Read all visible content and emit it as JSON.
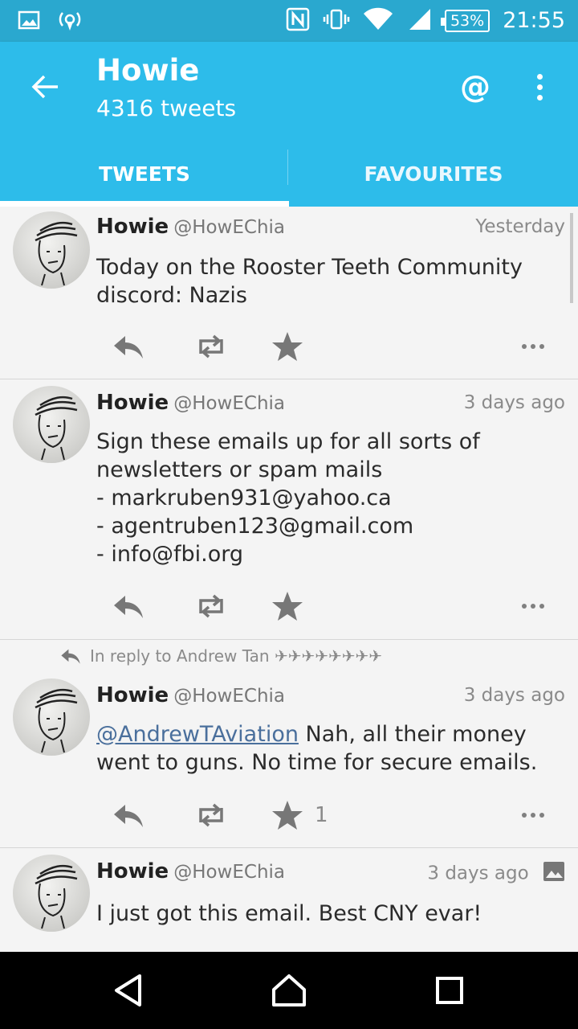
{
  "status_bar": {
    "battery": "53%",
    "time": "21:55",
    "icons": [
      "image-icon",
      "wifi-tether-icon",
      "nfc-icon",
      "vibrate-icon",
      "wifi-icon",
      "signal-icon",
      "battery-icon"
    ]
  },
  "app_bar": {
    "title": "Howie",
    "subtitle": "4316 tweets",
    "color": "#2dbcea"
  },
  "tabs": [
    {
      "label": "TWEETS",
      "active": true
    },
    {
      "label": "FAVOURITES",
      "active": false
    }
  ],
  "tweets": [
    {
      "name": "Howie",
      "handle": "@HowEChia",
      "time": "Yesterday",
      "text": "Today on the Rooster Teeth Community discord: Nazis"
    },
    {
      "name": "Howie",
      "handle": "@HowEChia",
      "time": "3 days ago",
      "text": "Sign these emails up for all sorts of newsletters or spam mails\n- markruben931@yahoo.ca\n- agentruben123@gmail.com\n- info@fbi.org"
    },
    {
      "in_reply_to": "In reply to Andrew Tan ✈✈✈✈✈✈✈✈",
      "name": "Howie",
      "handle": "@HowEChia",
      "time": "3 days ago",
      "mention": "@AndrewTAviation",
      "text": " Nah, all their money went to guns. No time for secure emails.",
      "favourites": "1"
    },
    {
      "name": "Howie",
      "handle": "@HowEChia",
      "time": "3 days ago",
      "text": "I just got this email. Best CNY evar!"
    }
  ]
}
